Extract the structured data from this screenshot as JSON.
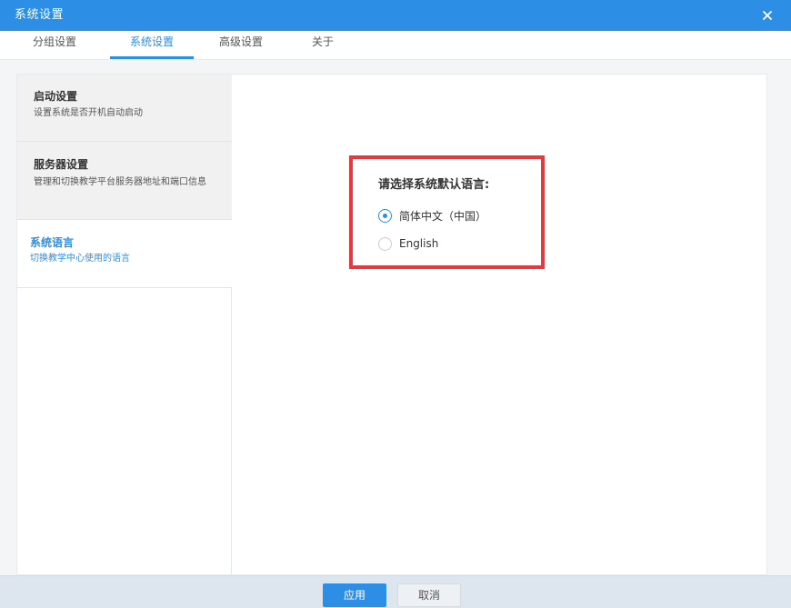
{
  "window": {
    "title": "系统设置",
    "accent_color": "#2c8ee5"
  },
  "tabs": [
    {
      "label": "分组设置",
      "active": false
    },
    {
      "label": "系统设置",
      "active": true
    },
    {
      "label": "高级设置",
      "active": false
    },
    {
      "label": "关于",
      "active": false
    }
  ],
  "sidebar": {
    "items": [
      {
        "title": "启动设置",
        "desc": "设置系统是否开机自动启动",
        "active": false
      },
      {
        "title": "服务器设置",
        "desc": "管理和切换教学平台服务器地址和端口信息",
        "active": false
      },
      {
        "title": "系统语言",
        "desc": "切换教学中心使用的语言",
        "active": true
      }
    ]
  },
  "language": {
    "heading": "请选择系统默认语言:",
    "options": [
      {
        "label": "简体中文（中国）",
        "selected": true
      },
      {
        "label": "English",
        "selected": false
      }
    ],
    "highlight_color": "#e5393d"
  },
  "footer": {
    "apply_label": "应用",
    "cancel_label": "取消"
  }
}
